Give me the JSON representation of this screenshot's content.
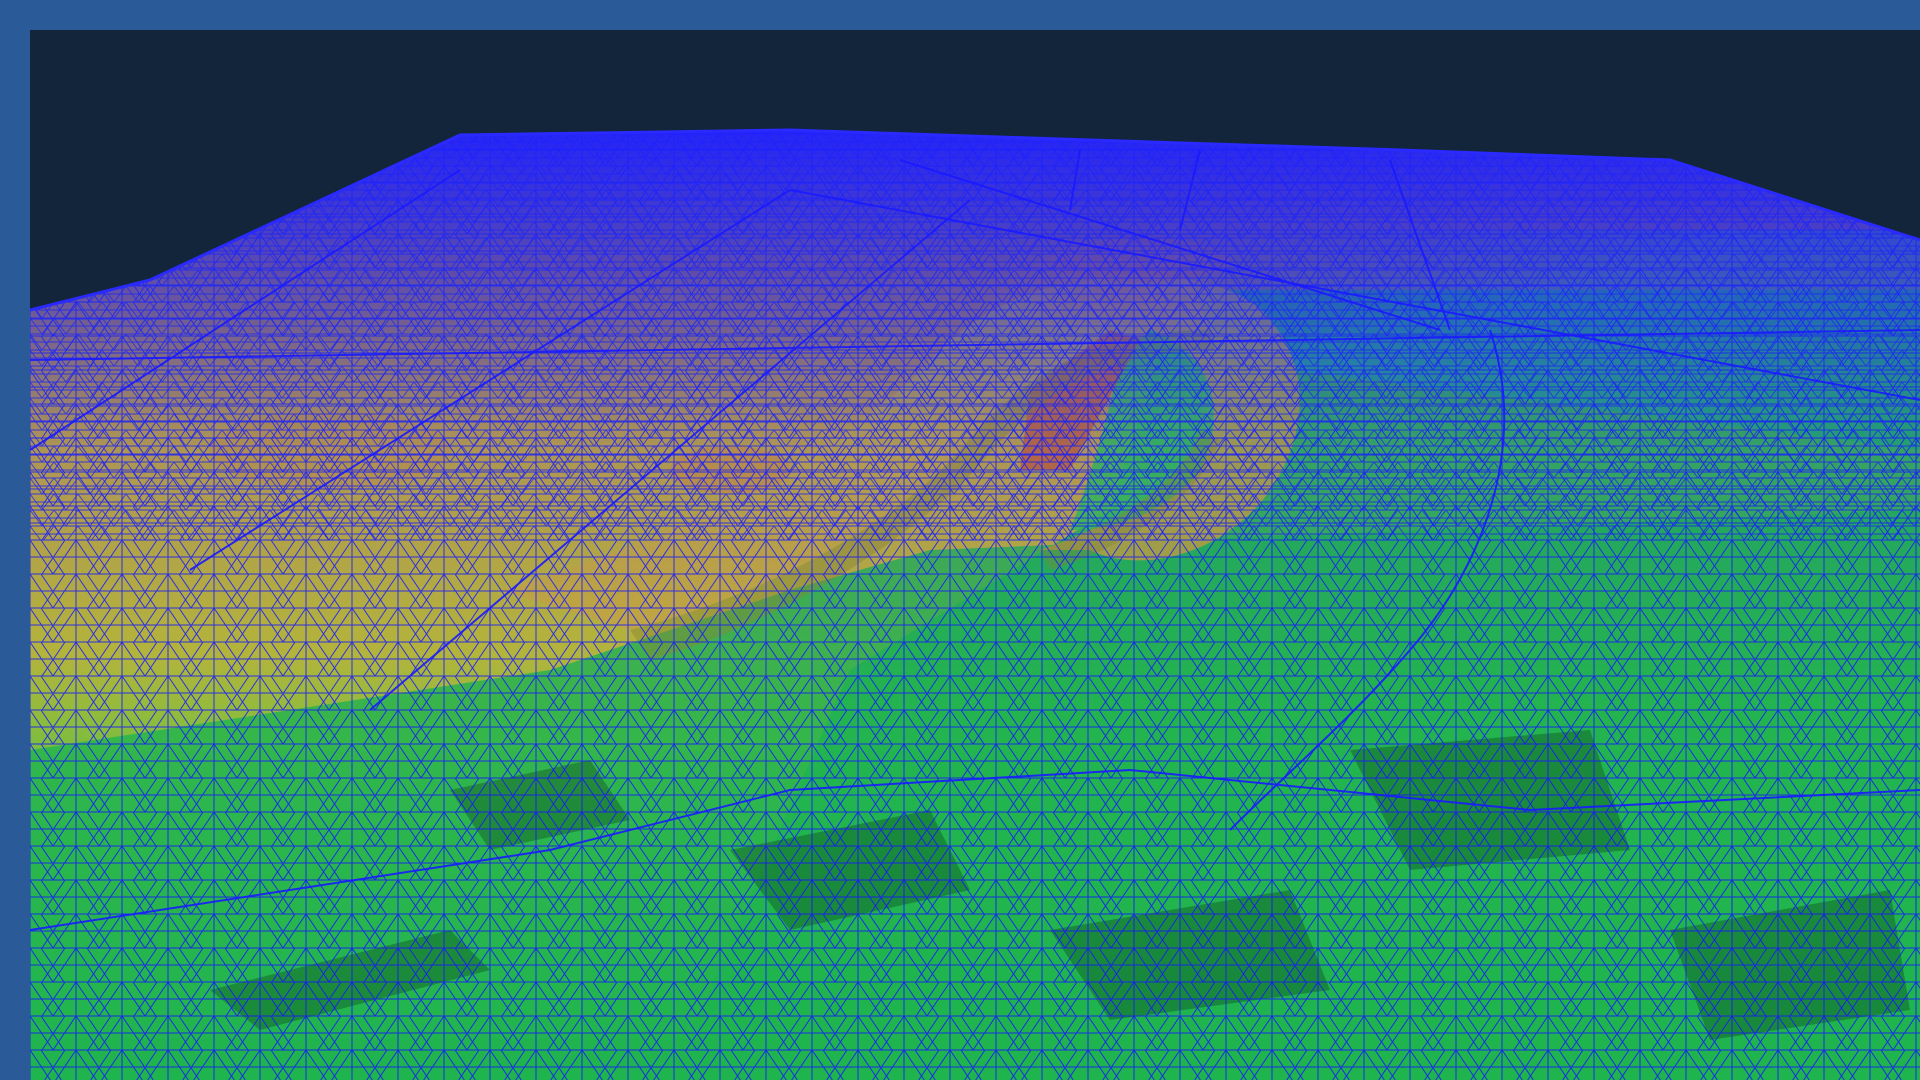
{
  "colors": {
    "frame": "#2b5a99",
    "sky": "#13253a",
    "mesh": "#1a1aff",
    "terrain_high": "#b46a2a",
    "terrain_mid": "#b8b030",
    "terrain_low": "#22b850"
  },
  "scene": {
    "type": "terrain-mesh-render"
  }
}
